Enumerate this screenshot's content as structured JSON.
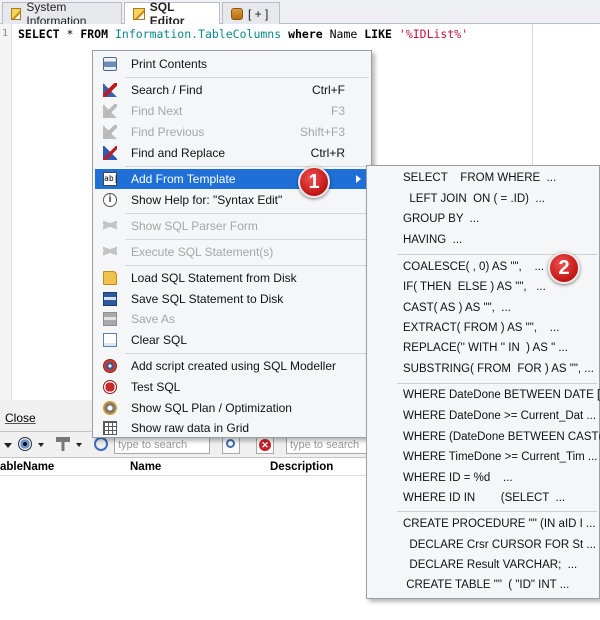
{
  "tabs": [
    {
      "label": "System Information",
      "icon": "pencil-icon"
    },
    {
      "label": "SQL Editor",
      "icon": "pencil-icon",
      "active": true
    },
    {
      "label": "[ + ]",
      "icon": "database-icon"
    }
  ],
  "editor": {
    "line_number": "1",
    "code": {
      "kw1": "SELECT",
      "star": " * ",
      "kw2": "FROM",
      "obj": "Information.TableColumns",
      "kw3": "where",
      "col": " Name ",
      "kw4": "LIKE",
      "str": "'%IDList%'"
    }
  },
  "panel": {
    "close_label": "Close",
    "search_placeholder_1": "type to search",
    "search_placeholder_2": "type to search",
    "columns": [
      "ableName",
      "Name",
      "Description"
    ]
  },
  "context_menu": {
    "items": [
      {
        "label": "Print Contents",
        "shortcut": "",
        "icon": "printer-icon",
        "enabled": true
      },
      {
        "label": "Search / Find",
        "shortcut": "Ctrl+F",
        "icon": "flashlight-icon",
        "enabled": true
      },
      {
        "label": "Find Next",
        "shortcut": "F3",
        "icon": "flashlight-icon",
        "enabled": false
      },
      {
        "label": "Find Previous",
        "shortcut": "Shift+F3",
        "icon": "flashlight-icon",
        "enabled": false
      },
      {
        "label": "Find and Replace",
        "shortcut": "Ctrl+R",
        "icon": "replace-icon",
        "enabled": true
      },
      {
        "label": "Add From Template",
        "shortcut": "",
        "icon": "text-field-icon",
        "enabled": true,
        "highlighted": true
      },
      {
        "label": "Show Help for: \"Syntax Edit\"",
        "shortcut": "",
        "icon": "info-icon",
        "enabled": true
      },
      {
        "label": "Show SQL Parser Form",
        "shortcut": "",
        "icon": "lightning-icon",
        "enabled": false
      },
      {
        "label": "Execute SQL Statement(s)",
        "shortcut": "",
        "icon": "lightning-icon",
        "enabled": false
      },
      {
        "label": "Load SQL Statement from Disk",
        "shortcut": "",
        "icon": "folder-icon",
        "enabled": true
      },
      {
        "label": "Save SQL Statement to Disk",
        "shortcut": "",
        "icon": "save-icon",
        "enabled": true
      },
      {
        "label": "Save As",
        "shortcut": "",
        "icon": "save-icon",
        "enabled": false
      },
      {
        "label": "Clear SQL",
        "shortcut": "",
        "icon": "clear-page-icon",
        "enabled": true
      },
      {
        "label": "Add script created using SQL Modeller",
        "shortcut": "",
        "icon": "modeller-icon",
        "enabled": true
      },
      {
        "label": "Test SQL",
        "shortcut": "",
        "icon": "bug-icon",
        "enabled": true
      },
      {
        "label": "Show SQL Plan / Optimization",
        "shortcut": "",
        "icon": "plan-icon",
        "enabled": true
      },
      {
        "label": "Show raw data in Grid",
        "shortcut": "",
        "icon": "grid-icon",
        "enabled": true
      }
    ]
  },
  "submenu": {
    "items": [
      "SELECT    FROM WHERE  ...",
      "  LEFT JOIN  ON ( = .ID)  ...",
      "GROUP BY  ...",
      "HAVING  ...",
      "COALESCE( , 0) AS \"\",    ...",
      "IF( THEN  ELSE ) AS \"\",   ...",
      "CAST( AS ) AS \"\",  ...",
      "EXTRACT( FROM ) AS \"\",    ...",
      "REPLACE('' WITH '' IN  ) AS \" ...",
      "SUBSTRING( FROM  FOR ) AS \"\", ...",
      "WHERE DateDone BETWEEN DATE [ ...",
      "WHERE DateDone >= Current_Dat ...",
      "WHERE (DateDone BETWEEN CAST( ...",
      "WHERE TimeDone >= Current_Tim ...",
      "WHERE ID = %d    ...",
      "WHERE ID IN        (SELECT  ...",
      "CREATE PROCEDURE \"\" (IN aID I ...",
      "  DECLARE Crsr CURSOR FOR St ...",
      "  DECLARE Result VARCHAR;  ...",
      " CREATE TABLE \"\"  ( \"ID\" INT ..."
    ]
  },
  "badges": [
    "1",
    "2"
  ],
  "colors": {
    "highlight": "#1f6fd6",
    "badge": "#d01c1c",
    "string": "#c0133a",
    "object": "#0a8a8a"
  }
}
